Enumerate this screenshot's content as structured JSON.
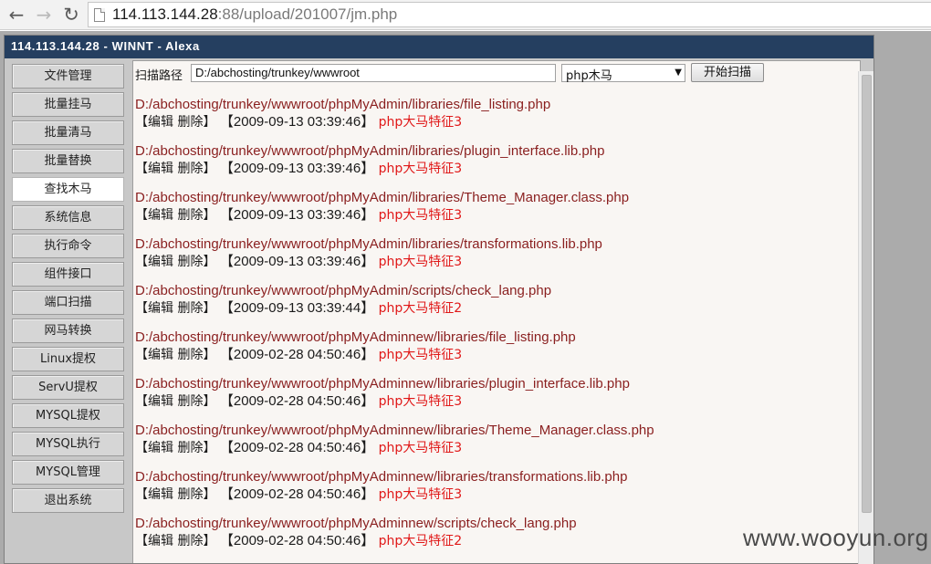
{
  "browser": {
    "url_host": "114.113.144.28",
    "url_rest": ":88/upload/201007/jm.php"
  },
  "window": {
    "title": "114.113.144.28 - WINNT - Alexa"
  },
  "sidebar": {
    "items": [
      {
        "label": "文件管理",
        "active": false
      },
      {
        "label": "批量挂马",
        "active": false
      },
      {
        "label": "批量清马",
        "active": false
      },
      {
        "label": "批量替换",
        "active": false
      },
      {
        "label": "查找木马",
        "active": true
      },
      {
        "label": "系统信息",
        "active": false
      },
      {
        "label": "执行命令",
        "active": false
      },
      {
        "label": "组件接口",
        "active": false
      },
      {
        "label": "端口扫描",
        "active": false
      },
      {
        "label": "网马转换",
        "active": false
      },
      {
        "label": "Linux提权",
        "active": false
      },
      {
        "label": "ServU提权",
        "active": false
      },
      {
        "label": "MYSQL提权",
        "active": false
      },
      {
        "label": "MYSQL执行",
        "active": false
      },
      {
        "label": "MYSQL管理",
        "active": false
      },
      {
        "label": "退出系统",
        "active": false
      }
    ]
  },
  "scan": {
    "label": "扫描路径",
    "path_value": "D:/abchosting/trunkey/wwwroot",
    "type_selected": "php木马",
    "button_label": "开始扫描"
  },
  "results": [
    {
      "path": "D:/abchosting/trunkey/wwwroot/phpMyAdmin/libraries/file_listing.php",
      "actions": "【编辑 删除】",
      "date": "【2009-09-13 03:39:46】",
      "signature": "php大马特征3"
    },
    {
      "path": "D:/abchosting/trunkey/wwwroot/phpMyAdmin/libraries/plugin_interface.lib.php",
      "actions": "【编辑 删除】",
      "date": "【2009-09-13 03:39:46】",
      "signature": "php大马特征3"
    },
    {
      "path": "D:/abchosting/trunkey/wwwroot/phpMyAdmin/libraries/Theme_Manager.class.php",
      "actions": "【编辑 删除】",
      "date": "【2009-09-13 03:39:46】",
      "signature": "php大马特征3"
    },
    {
      "path": "D:/abchosting/trunkey/wwwroot/phpMyAdmin/libraries/transformations.lib.php",
      "actions": "【编辑 删除】",
      "date": "【2009-09-13 03:39:46】",
      "signature": "php大马特征3"
    },
    {
      "path": "D:/abchosting/trunkey/wwwroot/phpMyAdmin/scripts/check_lang.php",
      "actions": "【编辑 删除】",
      "date": "【2009-09-13 03:39:44】",
      "signature": "php大马特征2"
    },
    {
      "path": "D:/abchosting/trunkey/wwwroot/phpMyAdminnew/libraries/file_listing.php",
      "actions": "【编辑 删除】",
      "date": "【2009-02-28 04:50:46】",
      "signature": "php大马特征3"
    },
    {
      "path": "D:/abchosting/trunkey/wwwroot/phpMyAdminnew/libraries/plugin_interface.lib.php",
      "actions": "【编辑 删除】",
      "date": "【2009-02-28 04:50:46】",
      "signature": "php大马特征3"
    },
    {
      "path": "D:/abchosting/trunkey/wwwroot/phpMyAdminnew/libraries/Theme_Manager.class.php",
      "actions": "【编辑 删除】",
      "date": "【2009-02-28 04:50:46】",
      "signature": "php大马特征3"
    },
    {
      "path": "D:/abchosting/trunkey/wwwroot/phpMyAdminnew/libraries/transformations.lib.php",
      "actions": "【编辑 删除】",
      "date": "【2009-02-28 04:50:46】",
      "signature": "php大马特征3"
    },
    {
      "path": "D:/abchosting/trunkey/wwwroot/phpMyAdminnew/scripts/check_lang.php",
      "actions": "【编辑 删除】",
      "date": "【2009-02-28 04:50:46】",
      "signature": "php大马特征2"
    }
  ],
  "watermark": "www.wooyun.org",
  "colors": {
    "title_bar": "#253f60",
    "path_text": "#8a1f1f",
    "signature_text": "#e01818",
    "content_bg": "#f9f6f3",
    "sidebar_bg": "#c8c8c8"
  }
}
